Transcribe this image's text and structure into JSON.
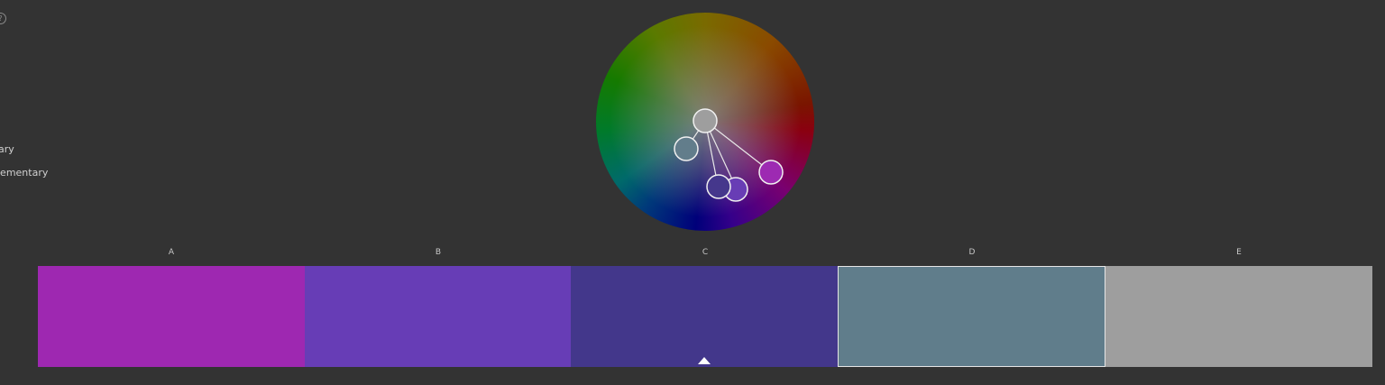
{
  "panel": {
    "help_icon": "help-circle-icon",
    "help_glyph": "?",
    "rules": [
      {
        "label": "ary"
      },
      {
        "label": "lementary"
      }
    ]
  },
  "wheel": {
    "markers": [
      {
        "id": "E",
        "color": "#9e9e9e"
      },
      {
        "id": "D",
        "color": "#627d8b"
      },
      {
        "id": "C",
        "color": "#45378c"
      },
      {
        "id": "B",
        "color": "#683db5"
      },
      {
        "id": "A",
        "color": "#9d2ab2"
      }
    ]
  },
  "swatches": [
    {
      "label": "A",
      "color": "#9e28b1",
      "selected": false,
      "base": false
    },
    {
      "label": "B",
      "color": "#673db6",
      "selected": false,
      "base": false
    },
    {
      "label": "C",
      "color": "#43378b",
      "selected": false,
      "base": true
    },
    {
      "label": "D",
      "color": "#607d8b",
      "selected": true,
      "base": false
    },
    {
      "label": "E",
      "color": "#9e9e9e",
      "selected": false,
      "base": false
    }
  ]
}
